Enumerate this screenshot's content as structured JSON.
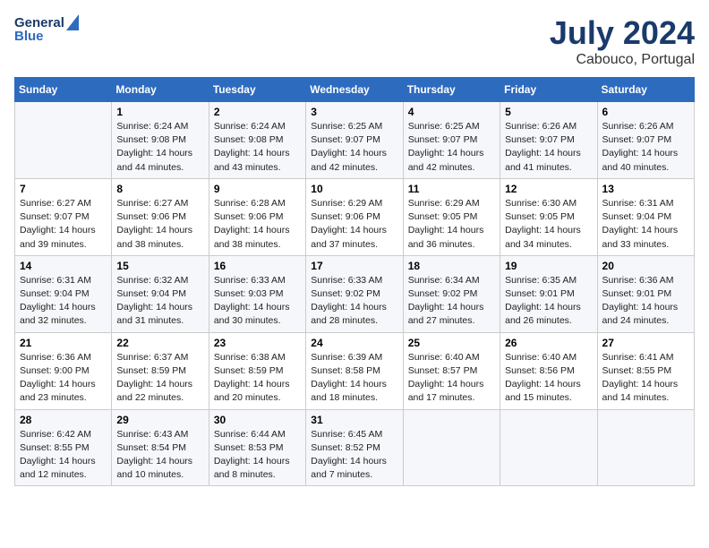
{
  "header": {
    "logo_general": "General",
    "logo_blue": "Blue",
    "main_title": "July 2024",
    "subtitle": "Cabouco, Portugal"
  },
  "columns": [
    "Sunday",
    "Monday",
    "Tuesday",
    "Wednesday",
    "Thursday",
    "Friday",
    "Saturday"
  ],
  "weeks": [
    [
      {
        "num": "",
        "info": ""
      },
      {
        "num": "1",
        "info": "Sunrise: 6:24 AM\nSunset: 9:08 PM\nDaylight: 14 hours\nand 44 minutes."
      },
      {
        "num": "2",
        "info": "Sunrise: 6:24 AM\nSunset: 9:08 PM\nDaylight: 14 hours\nand 43 minutes."
      },
      {
        "num": "3",
        "info": "Sunrise: 6:25 AM\nSunset: 9:07 PM\nDaylight: 14 hours\nand 42 minutes."
      },
      {
        "num": "4",
        "info": "Sunrise: 6:25 AM\nSunset: 9:07 PM\nDaylight: 14 hours\nand 42 minutes."
      },
      {
        "num": "5",
        "info": "Sunrise: 6:26 AM\nSunset: 9:07 PM\nDaylight: 14 hours\nand 41 minutes."
      },
      {
        "num": "6",
        "info": "Sunrise: 6:26 AM\nSunset: 9:07 PM\nDaylight: 14 hours\nand 40 minutes."
      }
    ],
    [
      {
        "num": "7",
        "info": "Sunrise: 6:27 AM\nSunset: 9:07 PM\nDaylight: 14 hours\nand 39 minutes."
      },
      {
        "num": "8",
        "info": "Sunrise: 6:27 AM\nSunset: 9:06 PM\nDaylight: 14 hours\nand 38 minutes."
      },
      {
        "num": "9",
        "info": "Sunrise: 6:28 AM\nSunset: 9:06 PM\nDaylight: 14 hours\nand 38 minutes."
      },
      {
        "num": "10",
        "info": "Sunrise: 6:29 AM\nSunset: 9:06 PM\nDaylight: 14 hours\nand 37 minutes."
      },
      {
        "num": "11",
        "info": "Sunrise: 6:29 AM\nSunset: 9:05 PM\nDaylight: 14 hours\nand 36 minutes."
      },
      {
        "num": "12",
        "info": "Sunrise: 6:30 AM\nSunset: 9:05 PM\nDaylight: 14 hours\nand 34 minutes."
      },
      {
        "num": "13",
        "info": "Sunrise: 6:31 AM\nSunset: 9:04 PM\nDaylight: 14 hours\nand 33 minutes."
      }
    ],
    [
      {
        "num": "14",
        "info": "Sunrise: 6:31 AM\nSunset: 9:04 PM\nDaylight: 14 hours\nand 32 minutes."
      },
      {
        "num": "15",
        "info": "Sunrise: 6:32 AM\nSunset: 9:04 PM\nDaylight: 14 hours\nand 31 minutes."
      },
      {
        "num": "16",
        "info": "Sunrise: 6:33 AM\nSunset: 9:03 PM\nDaylight: 14 hours\nand 30 minutes."
      },
      {
        "num": "17",
        "info": "Sunrise: 6:33 AM\nSunset: 9:02 PM\nDaylight: 14 hours\nand 28 minutes."
      },
      {
        "num": "18",
        "info": "Sunrise: 6:34 AM\nSunset: 9:02 PM\nDaylight: 14 hours\nand 27 minutes."
      },
      {
        "num": "19",
        "info": "Sunrise: 6:35 AM\nSunset: 9:01 PM\nDaylight: 14 hours\nand 26 minutes."
      },
      {
        "num": "20",
        "info": "Sunrise: 6:36 AM\nSunset: 9:01 PM\nDaylight: 14 hours\nand 24 minutes."
      }
    ],
    [
      {
        "num": "21",
        "info": "Sunrise: 6:36 AM\nSunset: 9:00 PM\nDaylight: 14 hours\nand 23 minutes."
      },
      {
        "num": "22",
        "info": "Sunrise: 6:37 AM\nSunset: 8:59 PM\nDaylight: 14 hours\nand 22 minutes."
      },
      {
        "num": "23",
        "info": "Sunrise: 6:38 AM\nSunset: 8:59 PM\nDaylight: 14 hours\nand 20 minutes."
      },
      {
        "num": "24",
        "info": "Sunrise: 6:39 AM\nSunset: 8:58 PM\nDaylight: 14 hours\nand 18 minutes."
      },
      {
        "num": "25",
        "info": "Sunrise: 6:40 AM\nSunset: 8:57 PM\nDaylight: 14 hours\nand 17 minutes."
      },
      {
        "num": "26",
        "info": "Sunrise: 6:40 AM\nSunset: 8:56 PM\nDaylight: 14 hours\nand 15 minutes."
      },
      {
        "num": "27",
        "info": "Sunrise: 6:41 AM\nSunset: 8:55 PM\nDaylight: 14 hours\nand 14 minutes."
      }
    ],
    [
      {
        "num": "28",
        "info": "Sunrise: 6:42 AM\nSunset: 8:55 PM\nDaylight: 14 hours\nand 12 minutes."
      },
      {
        "num": "29",
        "info": "Sunrise: 6:43 AM\nSunset: 8:54 PM\nDaylight: 14 hours\nand 10 minutes."
      },
      {
        "num": "30",
        "info": "Sunrise: 6:44 AM\nSunset: 8:53 PM\nDaylight: 14 hours\nand 8 minutes."
      },
      {
        "num": "31",
        "info": "Sunrise: 6:45 AM\nSunset: 8:52 PM\nDaylight: 14 hours\nand 7 minutes."
      },
      {
        "num": "",
        "info": ""
      },
      {
        "num": "",
        "info": ""
      },
      {
        "num": "",
        "info": ""
      }
    ]
  ]
}
